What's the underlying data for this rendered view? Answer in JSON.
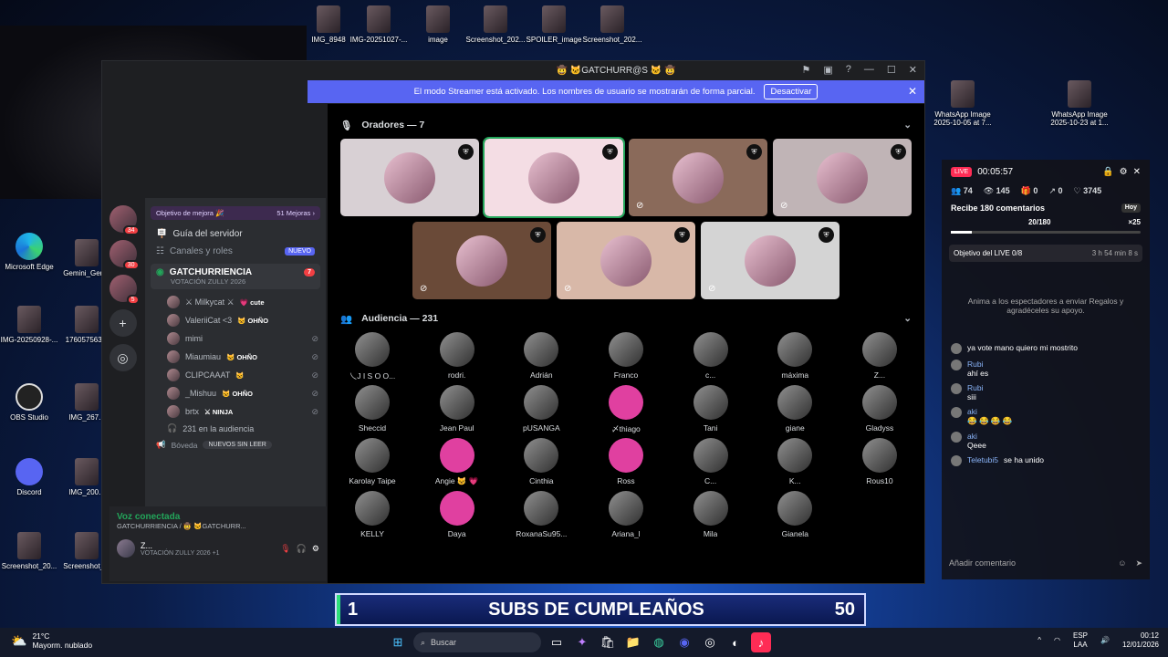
{
  "desktop": {
    "top_icons": [
      "IMG_8948",
      "IMG-20251027-...",
      "image",
      "Screenshot_202...",
      "SPOILER_image",
      "Screenshot_202..."
    ],
    "left_icons": [
      "Microsoft Edge",
      "Gemini_Gen...",
      "IMG-20250928-...",
      "176057563...",
      "OBS Studio",
      "IMG_267...",
      "Discord",
      "IMG_200...",
      "Screenshot_20...",
      "Screenshot_..."
    ],
    "right_icons": [
      "WhatsApp Image 2025-10-05 at 7...",
      "WhatsApp Image 2025-10-23 at 1..."
    ]
  },
  "discord": {
    "title": "🤠 🐱GATCHURR@S 🐱 🤠",
    "banner": {
      "text": "El modo Streamer está activado. Los nombres de usuario se mostrarán de forma parcial.",
      "button": "Desactivar"
    },
    "guild_badges": [
      "34",
      "30",
      "5"
    ],
    "boost": {
      "label": "Objetivo de mejora 🎉",
      "value": "51 Mejoras ›"
    },
    "channels": [
      {
        "label": "Guía del servidor"
      },
      {
        "label": "Canales y roles",
        "badge": "NUEVO"
      }
    ],
    "voice_channel": {
      "name": "GATCHURRIENCIA",
      "count": "7",
      "status": "VOTACIÓN ZULLY 2026"
    },
    "members": [
      {
        "name": "⚔ Milkycat ⚔",
        "tag": "💗 cute"
      },
      {
        "name": "ValeriiCat <3",
        "tag": "😺 OHÑO"
      },
      {
        "name": "mimi",
        "tag": ""
      },
      {
        "name": "Miaumiau",
        "tag": "😺 OHÑO"
      },
      {
        "name": "CLIPCAAAT",
        "tag": "😺"
      },
      {
        "name": "_Mishuu",
        "tag": "😺 OHÑO"
      },
      {
        "name": "brtx",
        "tag": "⚔ NINJA"
      }
    ],
    "audience_line": "231 en la audiencia",
    "lobby": "Bóveda",
    "new_unread": "NUEVOS SIN LEER",
    "voice": {
      "status": "Voz conectada",
      "sub": "GATCHURRIENCIA / 🤠 🐱GATCHURR..."
    },
    "user": {
      "name": "Z...",
      "status": "VOTACIÓN ZULLY 2026 +1"
    },
    "speakers_title": "Oradores — 7",
    "audience_title": "Audiencia — 231",
    "audience": [
      "乀J I S O O...",
      "rodri.",
      "Adrián",
      "Franco",
      "c...",
      "máxima",
      "Z...",
      "Sheccid",
      "Jean Paul",
      "pUSANGA",
      "〆thiago",
      "Tani",
      "giane",
      "Gladyss",
      "Karolay Taipe",
      "Angie 😺 💗",
      "Cinthia",
      "Ross",
      "C...",
      "K...",
      "Rous10",
      "KELLY",
      "Daya",
      "RoxanaSu95...",
      "Ariana_l",
      "Mila",
      "Gianela"
    ]
  },
  "live": {
    "badge": "LIVE",
    "time": "00:05:57",
    "stats": [
      "74",
      "145",
      "0",
      "0",
      "3745"
    ],
    "goal": {
      "title": "Recibe 180 comentarios",
      "tag": "Hoy",
      "progress": "20/180",
      "reward": "×25",
      "fraction": 0.11
    },
    "objective": {
      "label": "Objetivo del LIVE",
      "value": "0/8",
      "time": "3 h 54 min 8 s"
    },
    "tip": "Anima a los espectadores a enviar Regalos y agradéceles su apoyo.",
    "comments": [
      {
        "user": "",
        "text": "ya vote mano quiero mi mostrito"
      },
      {
        "user": "Rubi",
        "text": "ahí es"
      },
      {
        "user": "Rubi",
        "text": "siii"
      },
      {
        "user": "aki",
        "text": "😂 😂 😂 😂"
      },
      {
        "user": "aki",
        "text": "Qeee"
      },
      {
        "user": "Teletubi5",
        "text": "se ha unido"
      }
    ],
    "input": "Añadir comentario"
  },
  "overlay": {
    "left": "1",
    "center": "SUBS DE CUMPLEAÑOS",
    "right": "50"
  },
  "taskbar": {
    "temp": "21°C",
    "weather": "Mayorm. nublado",
    "search": "Buscar",
    "lang": "ESP",
    "lang2": "LAA",
    "time": "00:12",
    "date": "12/01/2026"
  }
}
